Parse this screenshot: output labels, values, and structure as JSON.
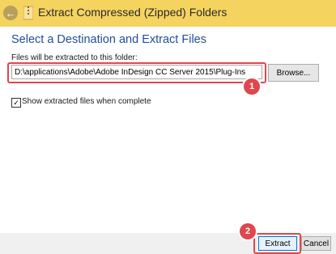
{
  "window": {
    "title": "Extract Compressed (Zipped) Folders",
    "back_icon": "arrow-left-icon",
    "app_icon": "zip-folder-icon",
    "titlebar_color": "#f4d35f"
  },
  "dialog": {
    "heading": "Select a Destination and Extract Files",
    "destination_label": "Files will be extracted to this folder:",
    "destination_value": "D:\\applications\\Adobe\\Adobe InDesign CC Server 2015\\Plug-Ins",
    "browse_label": "Browse...",
    "show_files_label": "Show extracted files when complete",
    "show_files_checked": true
  },
  "footer": {
    "extract_label": "Extract",
    "cancel_label": "Cancel"
  },
  "annotations": {
    "step1": "1",
    "step2": "2",
    "highlight_color": "#e0464e"
  }
}
